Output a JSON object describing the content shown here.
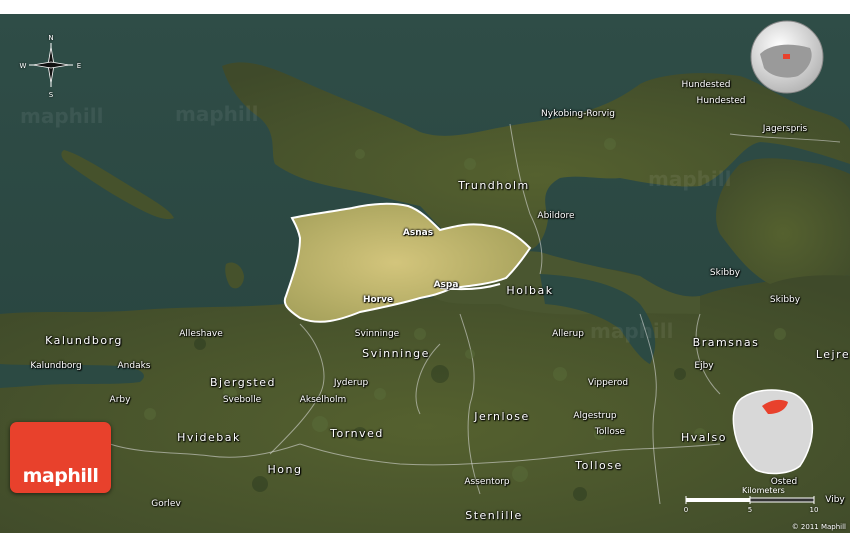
{
  "brand": {
    "logo_text": "maphill",
    "watermark": "maphill"
  },
  "compass": {
    "n": "N",
    "s": "S",
    "e": "E",
    "w": "W"
  },
  "scale": {
    "title": "Kilometers",
    "ticks": [
      "0",
      "5",
      "10"
    ]
  },
  "copyright": "© 2011 Maphill",
  "colors": {
    "water": "#2c4a43",
    "land": "#4e5a32",
    "highlight": "#c8c079",
    "logo": "#e8412c",
    "inset_highlight": "#e8412c"
  },
  "labels": {
    "region_trundholm": "Trundholm",
    "region_holbak": "Holbak",
    "region_svinninge": "Svinninge",
    "region_bjergsted": "Bjergsted",
    "region_hvidebak": "Hvidebak",
    "region_jernlose": "Jernlose",
    "region_tornved": "Tornved",
    "region_hong": "Hong",
    "region_tollose": "Tollose",
    "region_bramsnas": "Bramsnas",
    "region_hvalso": "Hvalso",
    "region_kalundborg": "Kalundborg",
    "region_lejre": "Lejre",
    "city_nykobing": "Nykobing-Rorvig",
    "city_hundested_1": "Hundested",
    "city_hundested_2": "Hundested",
    "city_jagerspris": "Jagerspris",
    "city_abildore": "Abildore",
    "city_asnas": "Asnas",
    "city_horve": "Horve",
    "city_aspa": "Aspa",
    "city_svinninge": "Svinninge",
    "city_alleshave": "Alleshave",
    "city_kalundborg": "Kalundborg",
    "city_andaks": "Andaks",
    "city_arby": "Arby",
    "city_svebolle": "Svebolle",
    "city_jyderup": "Jyderup",
    "city_akselholm": "Akselholm",
    "city_allerup": "Allerup",
    "city_vipperod": "Vipperod",
    "city_algestrup": "Algestrup",
    "city_tollose": "Tollose",
    "city_skibby_1": "Skibby",
    "city_skibby_2": "Skibby",
    "city_ejby": "Ejby",
    "city_gorlev": "Gorlev",
    "city_assentorp": "Assentorp",
    "city_stenlille": "Stenlille",
    "city_osted": "Osted",
    "city_viby": "Viby"
  }
}
